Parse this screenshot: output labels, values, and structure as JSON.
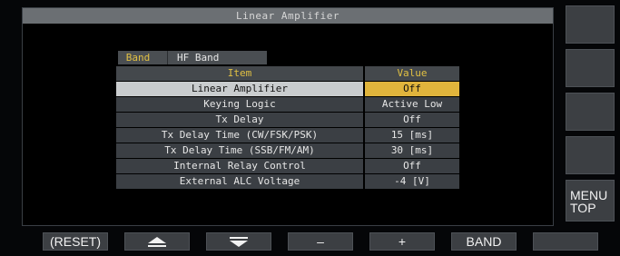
{
  "window": {
    "title": "Linear Amplifier"
  },
  "band": {
    "label": "Band",
    "value": "HF Band"
  },
  "table": {
    "headers": {
      "item": "Item",
      "value": "Value"
    },
    "rows": [
      {
        "item": "Linear Amplifier",
        "value": "Off",
        "selected": true
      },
      {
        "item": "Keying Logic",
        "value": "Active Low"
      },
      {
        "item": "Tx Delay",
        "value": "Off"
      },
      {
        "item": "Tx Delay Time (CW/FSK/PSK)",
        "value": "15 [ms]"
      },
      {
        "item": "Tx Delay Time (SSB/FM/AM)",
        "value": "30 [ms]"
      },
      {
        "item": "Internal Relay Control",
        "value": "Off"
      },
      {
        "item": "External ALC Voltage",
        "value": "-4 [V]"
      }
    ]
  },
  "side_keys": {
    "key1": "",
    "key2": "",
    "key3": "",
    "key4": "",
    "menu_top": {
      "line1": "MENU",
      "line2": "TOP"
    }
  },
  "bottom_keys": {
    "reset": "(RESET)",
    "up_icon": "triangle-up-icon",
    "down_icon": "triangle-down-icon",
    "minus": "–",
    "plus": "+",
    "band": "BAND",
    "blank": ""
  },
  "colors": {
    "accent_yellow": "#e1c043",
    "selected_value_bg": "#e0b43c",
    "selected_item_bg": "#c9ccce",
    "title_bar": "#6b6f73",
    "cell_bg": "#3b3f44"
  }
}
